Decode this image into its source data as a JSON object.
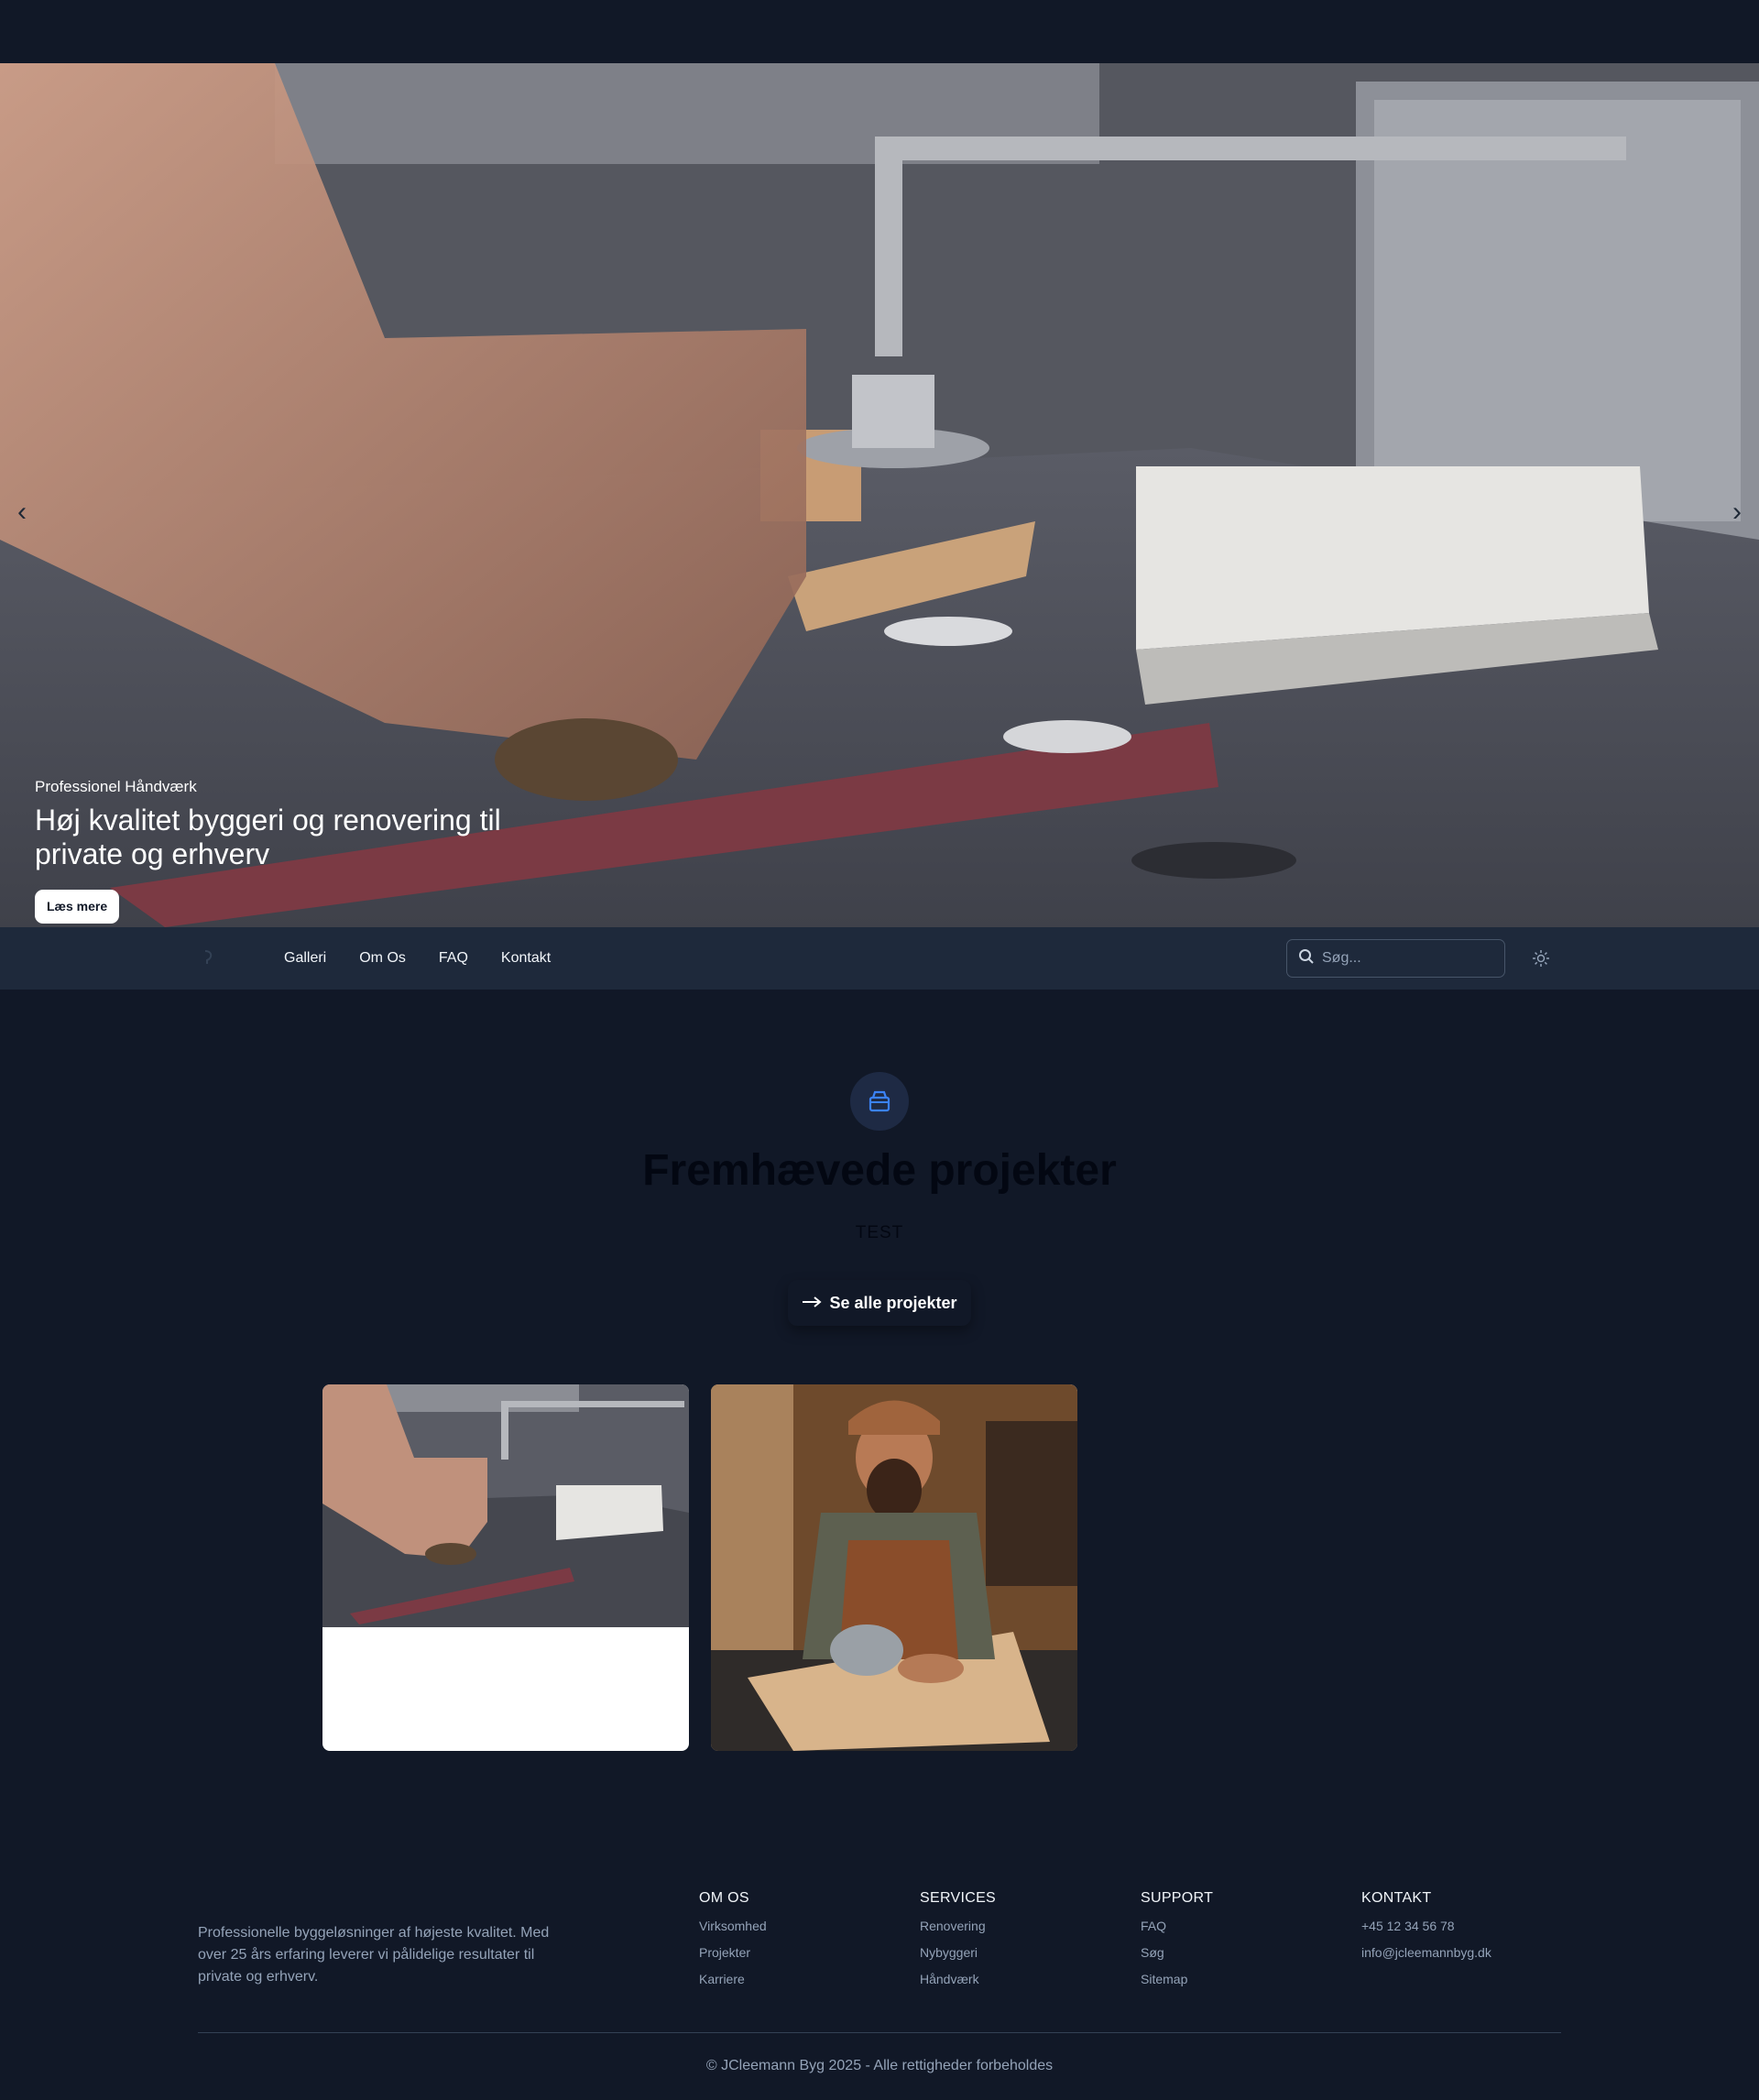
{
  "hero": {
    "eyebrow": "Professionel Håndværk",
    "title": "Høj kvalitet byggeri og renovering til private og erhverv",
    "button_label": "Læs mere",
    "prev_icon": "chevron-left-icon",
    "next_icon": "chevron-right-icon"
  },
  "nav": {
    "logo_icon": "logo-icon",
    "links": [
      "Galleri",
      "Om Os",
      "FAQ",
      "Kontakt"
    ],
    "search_placeholder": "Søg...",
    "theme_icon": "sun-icon"
  },
  "featured": {
    "icon": "package-icon",
    "title": "Fremhævede projekter",
    "subtitle": "TEST",
    "see_all_label": "Se alle projekter"
  },
  "footer": {
    "about": "Professionelle byggeløsninger af højeste kvalitet. Med over 25 års erfaring leverer vi pålidelige resultater til private og erhverv.",
    "columns": [
      {
        "title": "OM OS",
        "links": [
          "Virksomhed",
          "Projekter",
          "Karriere"
        ]
      },
      {
        "title": "SERVICES",
        "links": [
          "Renovering",
          "Nybyggeri",
          "Håndværk"
        ]
      },
      {
        "title": "SUPPORT",
        "links": [
          "FAQ",
          "Søg",
          "Sitemap"
        ]
      },
      {
        "title": "KONTAKT",
        "links": [
          "+45 12 34 56 78",
          "info@jcleemannbyg.dk"
        ]
      }
    ],
    "copyright": "© JCleemann Byg 2025 - Alle rettigheder forbeholdes"
  },
  "colors": {
    "background": "#111827",
    "navbar": "#1e293b",
    "accent": "#3b82f6"
  }
}
